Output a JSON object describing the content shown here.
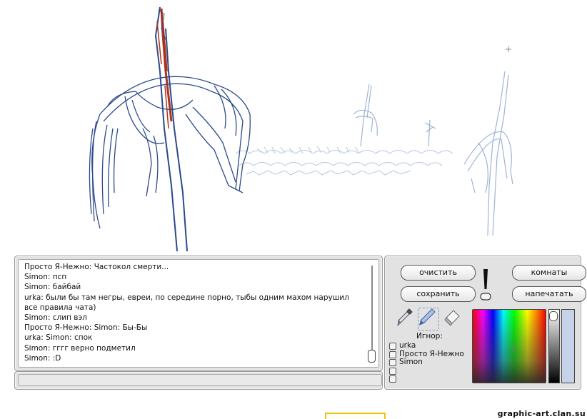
{
  "chat": {
    "messages": [
      "Просто Я-Нежно: Частокол смерти...",
      "Simon: псп",
      "Simon: байбай",
      "urka: были бы там негры, евреи, по середине порно, тыбы одним махом нарушил все правила чата)",
      "Simon: слип вэл",
      "Просто Я-Нежно: Simon: Бы-Бы",
      "urka:  Simon: спок",
      "Simon: гггг верно подметил",
      "Simon: :D"
    ],
    "input_value": ""
  },
  "toolbar": {
    "clear_label": "очистить",
    "save_label": "сохранить",
    "rooms_label": "комнаты",
    "print_label": "напечатать"
  },
  "tools": [
    "eyedropper-icon",
    "pen-icon",
    "eraser-icon"
  ],
  "ignore": {
    "label": "Игнор:",
    "users": [
      "urka",
      "Просто Я-Нежно",
      "Simon",
      "",
      ""
    ]
  },
  "colors": {
    "current_color": "#c6d2e8",
    "sketch_dark": "#2a4a8a",
    "sketch_light": "#9fb3d6",
    "sketch_red": "#b0301a"
  },
  "watermark": "graphic-art.clan.su"
}
